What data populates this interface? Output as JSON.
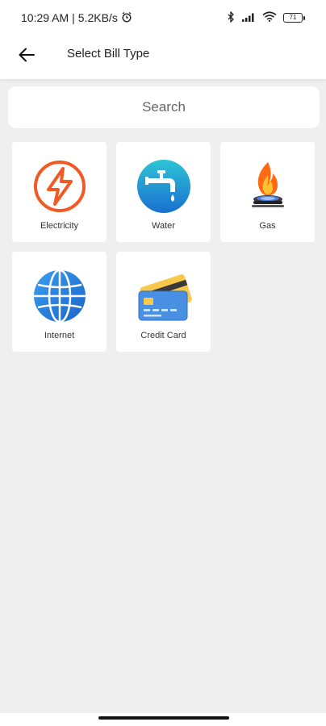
{
  "status_bar": {
    "time": "10:29 AM",
    "separator": "|",
    "speed": "5.2KB/s",
    "battery": "71"
  },
  "header": {
    "title": "Select Bill Type",
    "back_icon": "arrow-left-icon"
  },
  "search": {
    "placeholder": "Search",
    "value": ""
  },
  "bill_types": [
    {
      "label": "Electricity",
      "icon": "lightning-bolt-icon",
      "color": "#f15a24"
    },
    {
      "label": "Water",
      "icon": "water-tap-icon",
      "color": "#1aa7d9"
    },
    {
      "label": "Gas",
      "icon": "gas-flame-icon",
      "color": "#ff7a1a"
    },
    {
      "label": "Internet",
      "icon": "globe-icon",
      "color": "#2b8de0"
    },
    {
      "label": "Credit Card",
      "icon": "credit-card-icon",
      "color": "#4a90e2"
    }
  ]
}
